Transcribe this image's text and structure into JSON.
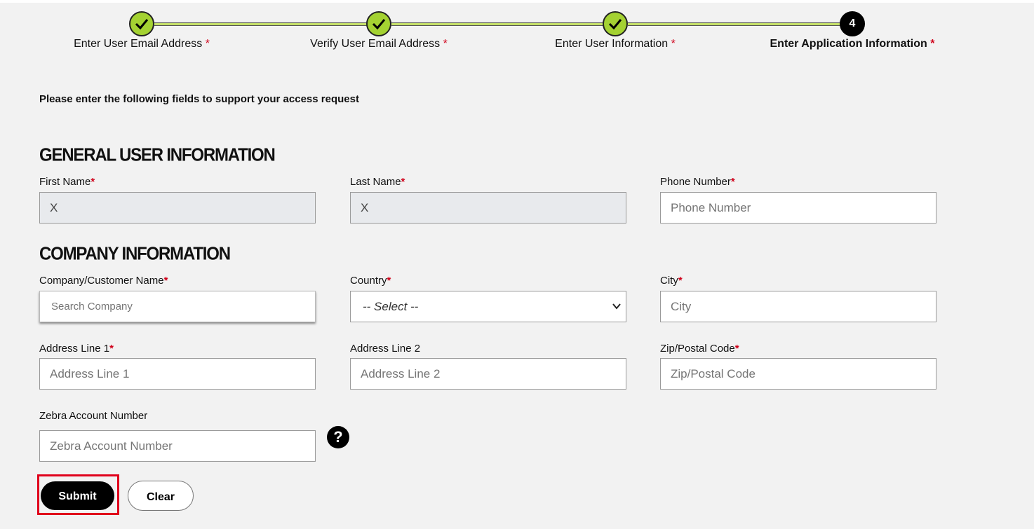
{
  "stepper": {
    "steps": [
      {
        "label": "Enter User Email Address",
        "required": "*",
        "status": "complete"
      },
      {
        "label": "Verify User Email Address",
        "required": "*",
        "status": "complete"
      },
      {
        "label": "Enter User Information",
        "required": "*",
        "status": "complete"
      },
      {
        "label": "Enter Application Information",
        "required": "*",
        "status": "current",
        "number": "4"
      }
    ]
  },
  "intro_text": "Please enter the following fields to support your access request",
  "general": {
    "title": "GENERAL USER INFORMATION",
    "first_name": {
      "label": "First Name",
      "required": "*",
      "value": "X"
    },
    "last_name": {
      "label": "Last Name",
      "required": "*",
      "value": "X"
    },
    "phone": {
      "label": "Phone Number",
      "required": "*",
      "placeholder": "Phone Number"
    }
  },
  "company": {
    "title": "COMPANY INFORMATION",
    "company_name": {
      "label": "Company/Customer Name",
      "required": "*",
      "placeholder": "Search Company"
    },
    "country": {
      "label": "Country",
      "required": "*",
      "selected": "-- Select --"
    },
    "city": {
      "label": "City",
      "required": "*",
      "placeholder": "City"
    },
    "address1": {
      "label": "Address Line 1",
      "required": "*",
      "placeholder": "Address Line 1"
    },
    "address2": {
      "label": "Address Line 2",
      "placeholder": "Address Line 2"
    },
    "zip": {
      "label": "Zip/Postal Code",
      "required": "*",
      "placeholder": "Zip/Postal Code"
    },
    "zebra_account": {
      "label": "Zebra Account Number",
      "placeholder": "Zebra Account Number"
    }
  },
  "help_icon_glyph": "?",
  "buttons": {
    "submit": "Submit",
    "clear": "Clear"
  },
  "colors": {
    "step_complete": "#a4d232",
    "required": "#d0021b",
    "highlight": "#e0001b"
  }
}
